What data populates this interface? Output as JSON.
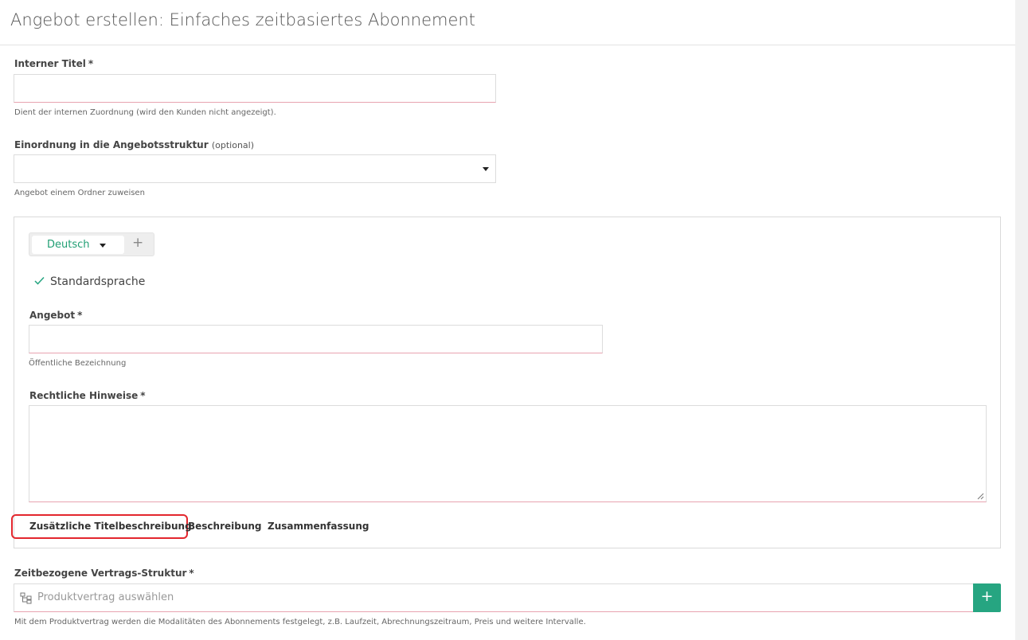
{
  "page": {
    "title": "Angebot erstellen: Einfaches zeitbasiertes Abonnement"
  },
  "internal_title": {
    "label": "Interner Titel",
    "required_mark": "*",
    "value": "",
    "help": "Dient der internen Zuordnung (wird den Kunden nicht angezeigt)."
  },
  "structure": {
    "label": "Einordnung in die Angebotsstruktur",
    "optional_note": "(optional)",
    "selected": "",
    "help": "Angebot einem Ordner zuweisen"
  },
  "language_panel": {
    "active_language": "Deutsch",
    "add_language_symbol": "+",
    "default_language_label": "Standardsprache",
    "offer": {
      "label": "Angebot",
      "required_mark": "*",
      "value": "",
      "help": "Öffentliche Bezeichnung"
    },
    "legal": {
      "label": "Rechtliche Hinweise",
      "required_mark": "*",
      "value": ""
    },
    "links": {
      "additional_title": "Zusätzliche Titelbeschreibung",
      "description": "Beschreibung",
      "summary": "Zusammenfassung"
    }
  },
  "contract": {
    "label": "Zeitbezogene Vertrags-Struktur",
    "required_mark": "*",
    "placeholder": "Produktvertrag auswählen",
    "add_symbol": "+",
    "help": "Mit dem Produktvertrag werden die Modalitäten des Abonnements festgelegt, z.B. Laufzeit, Abrechnungszeitraum, Preis und weitere Intervalle."
  },
  "colors": {
    "accent": "#26a581",
    "required_border": "#e8a3b0",
    "highlight": "#e3272e"
  },
  "icons": {
    "dropdown": "chevron-down-icon",
    "check": "check-icon",
    "tree": "tree-structure-icon",
    "plus": "plus-icon"
  }
}
